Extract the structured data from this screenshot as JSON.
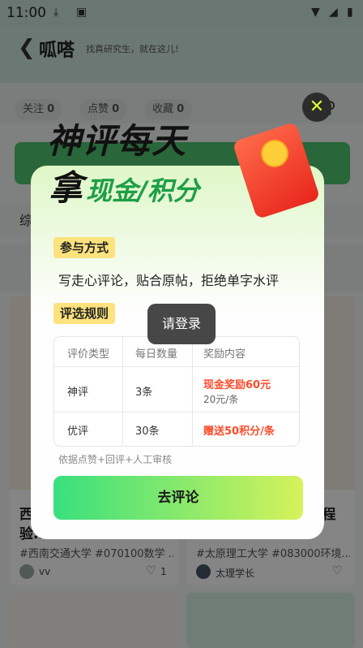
{
  "status_bar": {
    "time": "11:00"
  },
  "header": {
    "logo": "呱嗒",
    "slogan": "找真研究生，就在这儿!"
  },
  "stats": [
    {
      "label": "关注",
      "count": "0"
    },
    {
      "label": "点赞",
      "count": "0"
    },
    {
      "label": "收藏",
      "count": "0"
    }
  ],
  "cards": [
    {
      "title": "西...",
      "title2": "验...",
      "tags": "#西南交通大学 #070100数学 ...",
      "user": "vv",
      "likes": "1"
    },
    {
      "title": "...程",
      "tags": "#太原理工大学 #083000环境...",
      "user": "太理学长",
      "likes": ""
    }
  ],
  "modal": {
    "headline_line1": "神评每天",
    "headline_line2_prefix": "拿",
    "headline_line2_highlight": "现金/积分",
    "section1_label": "参与方式",
    "section1_text": "写走心评论，贴合原帖，拒绝单字水评",
    "section2_label": "评选规则",
    "table": {
      "headers": [
        "评价类型",
        "每日数量",
        "奖励内容"
      ],
      "rows": [
        {
          "type": "神评",
          "count": "3条",
          "reward": "现金奖励60元",
          "reward_sub": "20元/条"
        },
        {
          "type": "优评",
          "count": "30条",
          "reward": "赠送50积分/条",
          "reward_sub": ""
        }
      ]
    },
    "note": "依据点赞+回评+人工审核",
    "cta_label": "去评论"
  },
  "toast": "请登录"
}
